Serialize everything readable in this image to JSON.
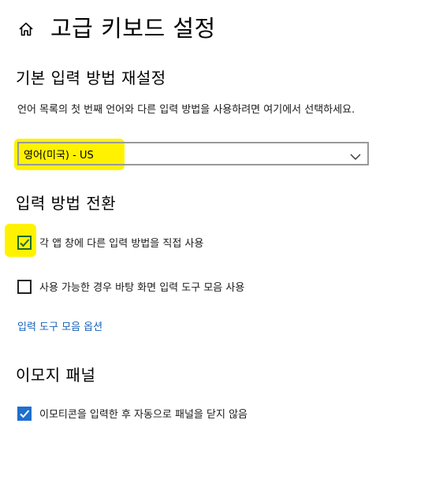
{
  "header": {
    "title": "고급 키보드 설정",
    "home_icon": "home-icon"
  },
  "default_input": {
    "heading": "기본 입력 방법 재설정",
    "description": "언어 목록의 첫 번째 언어와 다른 입력 방법을 사용하려면 여기에서 선택하세요.",
    "selected": "영어(미국) - US"
  },
  "switching": {
    "heading": "입력 방법 전환",
    "per_app": {
      "label": "각 앱 창에 다른 입력 방법을 직접 사용",
      "checked": true
    },
    "desktop_bar": {
      "label": "사용 가능한 경우 바탕 화면 입력 도구 모음 사용",
      "checked": false
    },
    "bar_options_link": "입력 도구 모음 옵션"
  },
  "emoji": {
    "heading": "이모지 패널",
    "auto_close": {
      "label": "이모티콘을 입력한 후 자동으로 패널을 닫지 않음",
      "checked": true
    }
  },
  "colors": {
    "highlight": "#fff200",
    "link": "#1a62b8",
    "checkbox_blue": "#1e6fcf",
    "checkmark_green": "#1f6a33"
  }
}
